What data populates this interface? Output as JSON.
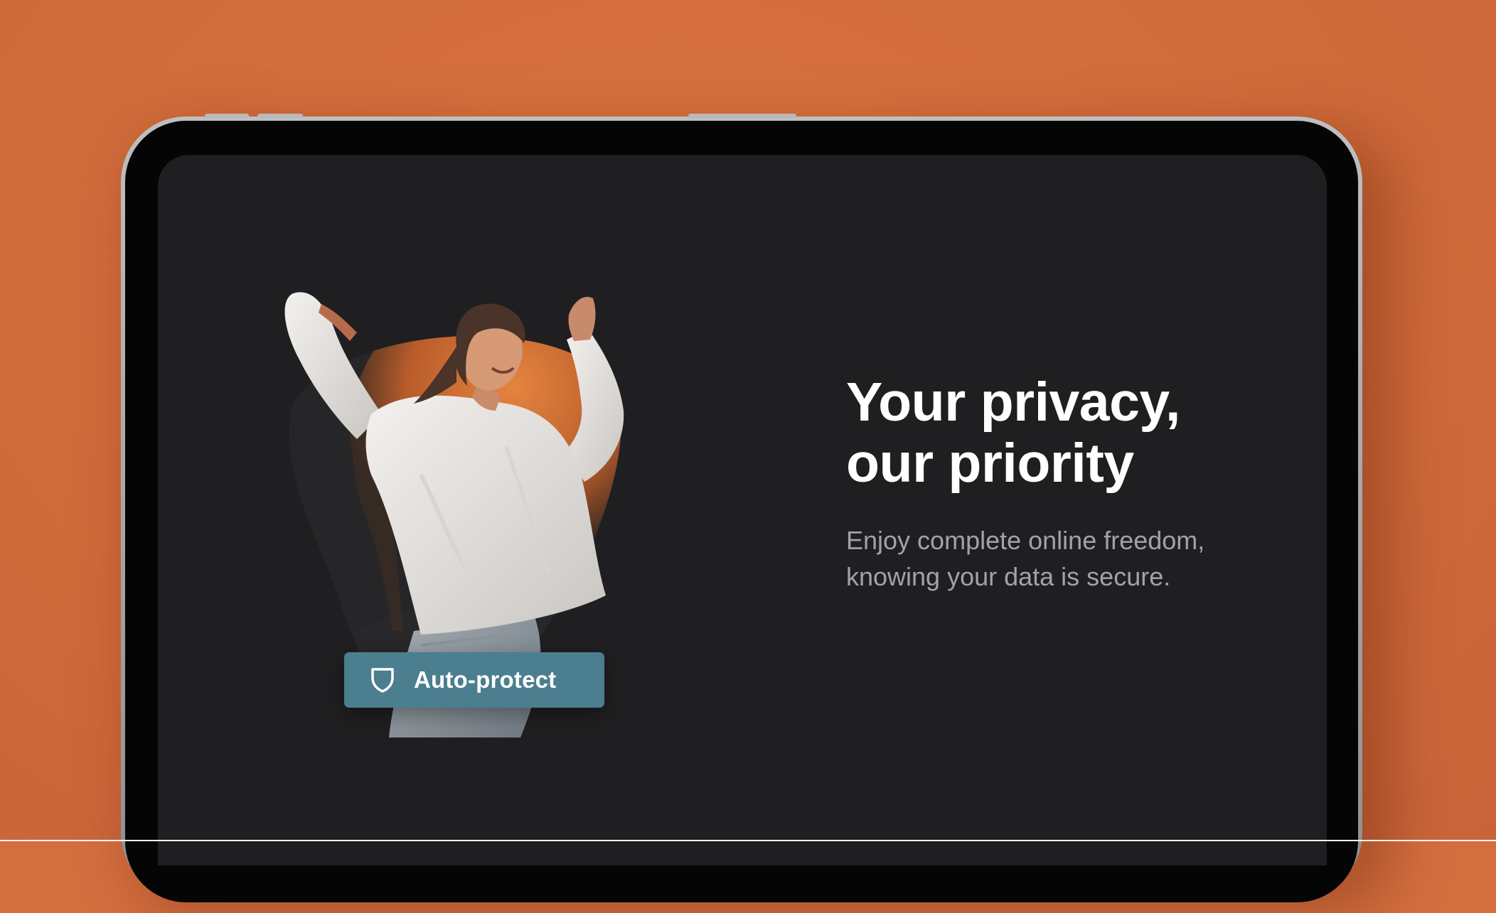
{
  "hero": {
    "image": "woman-dancing-photo",
    "badge": {
      "icon": "shield-icon",
      "label": "Auto-protect"
    }
  },
  "content": {
    "headline_line1": "Your privacy,",
    "headline_line2": "our priority",
    "subtext_line1": "Enjoy complete online freedom,",
    "subtext_line2": "knowing your data is secure."
  },
  "colors": {
    "background": "#d36e3f",
    "screen": "#1f1f21",
    "badge": "#4b7e8f",
    "accent_orange": "#d9783c",
    "subtext": "#a3a3a6"
  }
}
